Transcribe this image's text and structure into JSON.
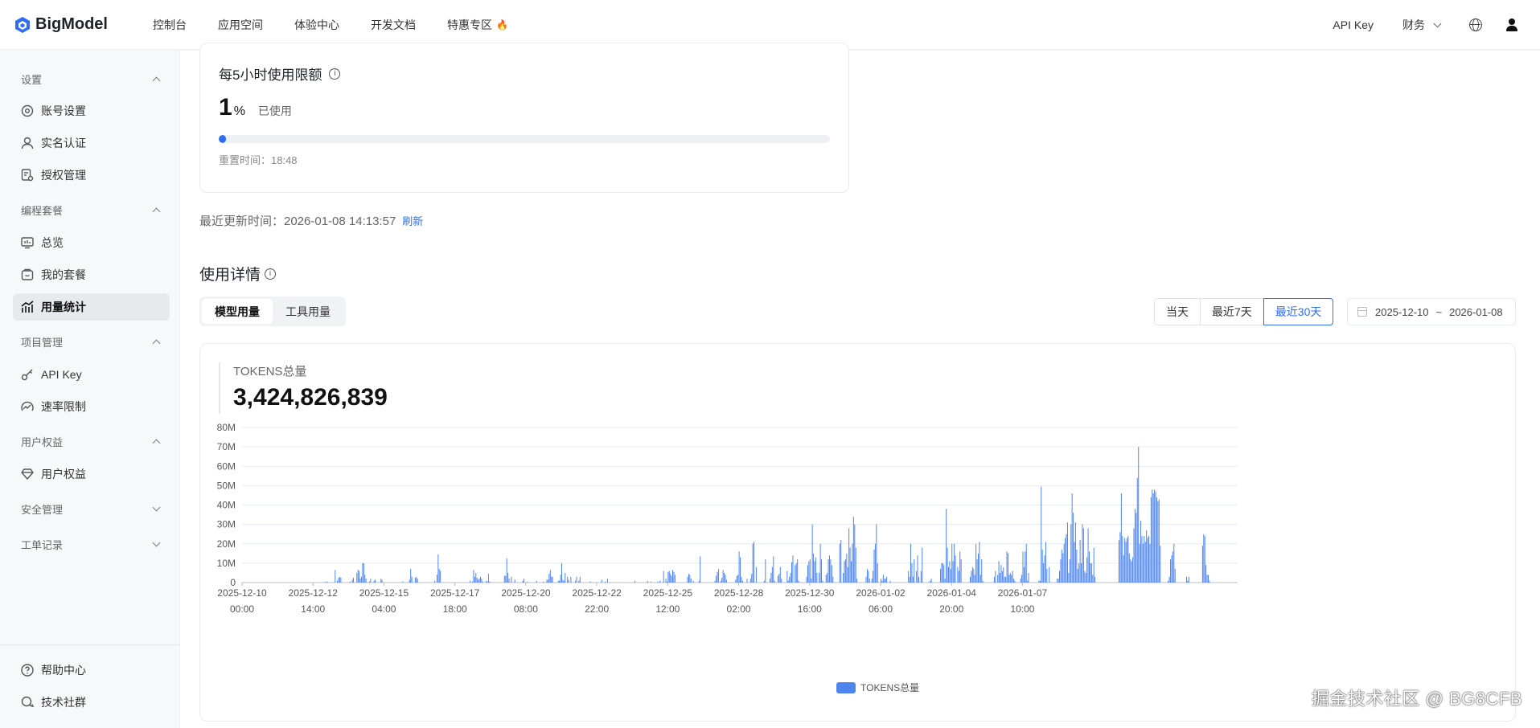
{
  "brand": {
    "name": "BigModel",
    "accent": "#2f6df6"
  },
  "nav": {
    "items": [
      "控制台",
      "应用空间",
      "体验中心",
      "开发文档",
      "特惠专区"
    ],
    "api_key": "API Key",
    "finance": "财务"
  },
  "sidebar": {
    "group_settings": "设置",
    "account": "账号设置",
    "realname": "实名认证",
    "auth": "授权管理",
    "group_coding": "编程套餐",
    "overview": "总览",
    "my_plan": "我的套餐",
    "usage": "用量统计",
    "group_project": "项目管理",
    "apikey": "API Key",
    "rate": "速率限制",
    "group_rights": "用户权益",
    "rights": "用户权益",
    "group_security": "安全管理",
    "group_ticket": "工单记录",
    "help": "帮助中心",
    "community": "技术社群"
  },
  "quota": {
    "title": "每5小时使用限额",
    "percent": "1",
    "percent_unit": "%",
    "used_label": "已使用",
    "used_fraction": 0.01,
    "reset": "重置时间：18:48"
  },
  "updated": {
    "label": "最近更新时间：2026-01-08 14:13:57",
    "refresh": "刷新"
  },
  "details": {
    "title": "使用详情",
    "tabs": [
      "模型用量",
      "工具用量"
    ],
    "ranges": [
      "当天",
      "最近7天",
      "最近30天"
    ],
    "date_from": "2025-12-10",
    "date_sep": "~",
    "date_to": "2026-01-08"
  },
  "kpi": {
    "label": "TOKENS总量",
    "value": "3,424,826,839"
  },
  "chart_data": {
    "type": "bar",
    "series_name": "TOKENS总量",
    "color": "#4e86f0",
    "y_ticks": [
      "0",
      "10M",
      "20M",
      "30M",
      "40M",
      "50M",
      "60M",
      "70M",
      "80M"
    ],
    "ylim": [
      0,
      80
    ],
    "y_unit": "M",
    "x_ticks": [
      {
        "date": "2025-12-10",
        "time": "00:00"
      },
      {
        "date": "2025-12-12",
        "time": "14:00"
      },
      {
        "date": "2025-12-15",
        "time": "04:00"
      },
      {
        "date": "2025-12-17",
        "time": "18:00"
      },
      {
        "date": "2025-12-20",
        "time": "08:00"
      },
      {
        "date": "2025-12-22",
        "time": "22:00"
      },
      {
        "date": "2025-12-25",
        "time": "12:00"
      },
      {
        "date": "2025-12-28",
        "time": "02:00"
      },
      {
        "date": "2025-12-30",
        "time": "16:00"
      },
      {
        "date": "2026-01-02",
        "time": "06:00"
      },
      {
        "date": "2026-01-04",
        "time": "20:00"
      },
      {
        "date": "2026-01-07",
        "time": "10:00"
      }
    ],
    "x_label_every_hours": 62,
    "values": [
      0,
      0,
      0,
      0,
      0,
      0,
      0,
      0,
      0,
      0,
      0,
      0,
      0,
      0,
      0,
      0,
      0,
      0,
      0,
      0,
      0,
      0,
      0,
      0,
      0,
      0,
      0,
      0,
      0,
      0,
      0,
      0,
      0,
      0,
      0,
      0,
      0,
      0,
      0,
      0,
      0,
      0,
      0,
      0,
      0,
      0,
      0,
      0,
      0,
      0,
      0,
      0,
      0,
      0,
      0,
      0,
      0,
      0,
      0,
      0,
      0,
      0,
      0,
      0,
      0,
      0,
      0,
      0,
      0,
      0,
      0,
      0,
      0.3,
      0.2,
      0.5,
      0,
      0,
      0,
      0,
      0.2,
      0,
      6.5,
      0,
      1,
      2.5,
      3,
      2.5,
      0,
      0,
      0,
      0,
      0,
      0,
      0,
      0.5,
      0,
      1.5,
      2.5,
      0,
      0,
      5,
      6.5,
      6,
      2,
      3,
      10,
      10,
      4,
      2,
      0,
      0,
      0.5,
      2,
      0,
      0,
      1,
      1.5,
      0,
      0,
      0,
      0,
      2,
      1.5,
      0,
      0,
      0,
      0,
      0,
      0,
      0,
      0,
      0,
      0,
      0,
      0,
      0,
      0,
      0,
      0,
      0,
      0.5,
      0,
      0,
      0,
      0,
      0,
      1.5,
      7,
      3,
      0,
      0,
      2.5,
      3,
      2,
      0,
      0,
      0,
      0,
      0,
      0,
      0,
      0,
      0,
      0,
      0,
      0,
      0,
      0,
      1,
      0,
      4,
      14.5,
      7,
      6,
      0,
      0,
      0,
      0,
      0,
      0,
      0,
      0,
      0,
      0,
      0,
      0,
      0,
      0,
      0,
      0,
      0,
      0,
      0,
      0,
      0,
      0,
      0,
      0,
      0,
      1,
      0,
      0.5,
      6.5,
      3,
      5,
      2.5,
      1.5,
      2,
      3,
      2,
      0.5,
      0,
      0,
      1,
      0.5,
      4.5,
      0.5,
      0,
      0,
      0,
      0,
      0,
      0,
      0,
      0,
      0,
      0,
      0,
      0,
      3.5,
      3.5,
      12.5,
      5,
      2,
      0,
      3,
      0,
      0,
      1.5,
      0,
      0,
      0,
      0,
      0,
      0,
      1,
      2,
      0,
      0,
      0.5,
      0,
      0,
      0,
      0,
      0,
      0,
      0,
      1,
      0,
      0,
      0,
      0,
      0,
      0.5,
      0,
      0,
      1.5,
      1.5,
      4.5,
      6.5,
      3,
      3,
      0,
      0,
      0,
      0,
      1,
      1,
      4,
      10,
      1.5,
      1,
      5,
      0,
      3,
      1.5,
      0,
      3,
      0,
      0,
      0,
      1,
      3,
      0,
      1,
      3,
      0,
      0,
      0,
      0,
      0,
      0,
      0,
      0,
      0.5,
      0,
      0,
      0,
      0,
      0,
      0,
      0,
      0,
      0,
      1.5,
      0,
      0,
      0.5,
      0,
      2,
      0,
      0,
      0,
      0,
      0,
      0,
      0,
      0,
      0,
      0,
      0,
      0,
      0,
      0,
      0,
      0,
      0,
      0,
      0,
      0,
      0,
      0,
      0,
      1,
      0,
      0,
      0,
      0,
      0,
      0,
      0,
      0,
      0,
      0,
      1,
      0,
      0,
      0.5,
      0,
      0,
      0,
      0,
      0,
      0.5,
      0,
      1,
      0,
      0,
      6,
      0,
      2,
      0.5,
      5.5,
      6,
      4.5,
      3.5,
      6.5,
      5.5,
      4,
      0,
      0,
      0,
      0,
      0,
      0,
      0,
      0,
      0,
      0,
      3,
      4.5,
      4,
      2,
      0,
      1,
      0,
      0,
      0,
      0,
      1,
      13.5,
      0,
      0,
      0,
      0,
      0,
      0,
      0,
      0,
      0,
      0,
      0,
      0,
      1,
      3.5,
      5.5,
      7,
      0,
      1,
      2.5,
      6.5,
      5,
      4,
      1.5,
      0,
      0,
      0,
      0,
      0,
      0,
      0,
      1.5,
      3.5,
      4,
      16,
      13,
      3,
      1,
      0,
      0,
      0,
      2,
      0,
      0,
      2,
      4.5,
      20,
      21,
      0,
      8,
      0,
      0,
      0,
      0,
      0,
      0,
      1,
      12,
      0,
      0,
      0,
      2,
      5,
      8,
      13.5,
      1,
      0,
      0,
      3.5,
      4.5,
      8,
      2,
      0,
      0,
      0,
      0,
      6,
      1,
      3,
      5,
      10.5,
      14,
      0,
      9,
      10,
      12,
      1,
      0,
      0,
      0,
      0,
      0,
      0,
      3,
      9,
      11,
      12,
      2,
      30,
      15,
      11,
      13,
      5,
      0,
      5,
      20,
      12,
      1,
      0,
      0,
      4,
      5,
      12,
      14,
      12,
      9,
      3,
      0,
      0,
      0,
      0,
      0,
      20,
      22,
      0,
      5,
      11,
      12,
      15,
      8,
      28,
      18,
      11,
      20,
      34,
      30,
      18,
      2,
      0,
      0,
      0,
      0,
      0,
      0,
      0,
      3,
      7,
      6,
      2,
      0,
      2,
      6,
      17,
      20,
      30,
      10,
      0,
      0,
      2,
      1,
      4,
      2,
      2,
      3,
      0,
      0,
      1,
      0,
      0,
      0,
      0,
      0,
      0,
      0,
      0,
      0,
      0,
      0,
      0,
      0,
      0,
      0,
      6,
      3,
      20,
      10,
      3,
      12,
      0,
      6,
      14,
      3,
      0,
      6,
      18,
      0,
      0,
      0,
      0,
      0,
      0,
      1,
      2,
      0,
      0,
      0,
      0,
      0,
      0,
      0,
      7,
      10,
      10,
      9,
      2,
      38,
      18,
      8,
      11,
      7,
      20,
      11,
      20,
      14,
      0,
      8,
      6,
      16,
      12,
      0,
      0,
      0,
      0,
      0,
      0,
      0,
      3,
      6,
      8,
      7,
      4,
      20,
      12,
      15,
      21,
      4,
      12,
      1,
      0,
      0,
      0,
      0,
      0,
      0,
      0,
      0,
      0,
      3,
      6,
      0,
      4,
      11,
      5,
      9,
      6,
      8,
      3,
      3,
      16,
      15,
      4,
      5,
      4,
      6,
      2,
      1,
      0,
      0,
      0,
      0,
      2,
      4,
      16,
      8,
      16,
      20,
      1,
      5,
      0,
      0,
      0,
      0,
      0,
      0,
      0,
      0,
      1,
      1,
      49.5,
      17,
      10,
      14,
      21,
      7,
      0,
      8,
      0,
      0,
      0,
      0,
      0,
      0,
      2,
      2,
      6,
      12,
      17,
      15,
      20,
      23,
      25,
      31,
      5,
      12,
      30,
      46,
      36,
      21,
      31,
      17,
      7,
      10,
      22,
      10,
      30,
      28,
      6,
      5,
      13,
      28,
      16,
      10,
      10,
      4,
      18,
      3,
      0,
      0,
      0,
      0,
      0,
      0,
      0,
      0,
      0,
      0,
      0,
      0,
      0,
      0,
      0,
      0,
      0,
      0,
      0,
      0,
      22,
      26,
      46,
      24,
      14,
      23,
      21,
      23,
      24,
      15,
      12,
      11,
      13,
      28,
      38,
      36,
      54,
      70,
      20,
      32,
      24,
      20,
      24,
      21,
      27,
      23,
      24,
      20,
      44,
      48,
      46,
      48,
      47,
      44,
      42,
      43,
      19,
      0,
      0,
      0,
      0,
      0,
      0,
      1,
      3,
      12,
      14,
      16,
      20,
      7,
      0,
      0,
      0,
      0,
      0,
      0,
      0,
      0,
      0,
      3,
      1,
      3,
      0,
      0,
      0,
      0,
      0,
      0,
      0,
      0,
      0,
      0,
      0,
      19,
      25,
      24,
      9,
      4,
      4,
      1,
      0,
      0,
      0,
      0,
      0,
      0,
      0,
      0,
      0,
      0,
      0,
      0,
      0,
      0,
      0,
      0,
      0,
      0,
      0,
      0,
      0,
      0,
      0,
      0
    ]
  },
  "watermark": "掘金技术社区 @ BG8CFB"
}
